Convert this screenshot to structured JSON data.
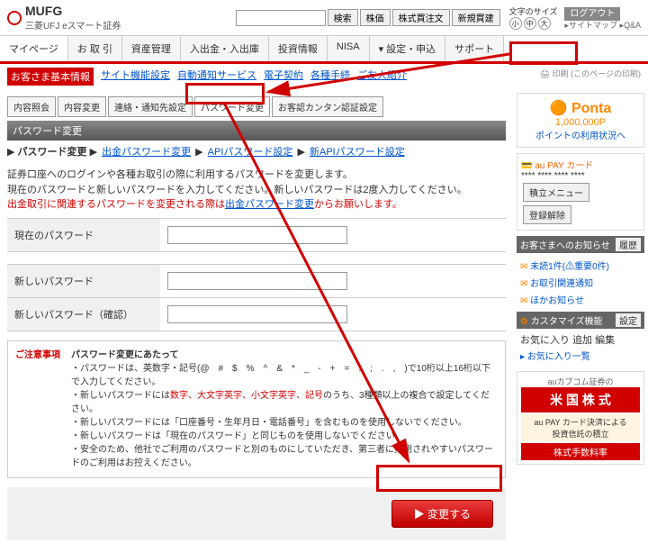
{
  "header": {
    "brand": "MUFG",
    "brand_sub": "三菱UFJ eスマート証券",
    "search_btn": "検索",
    "btn_price": "株価",
    "btn_order": "株式買注文",
    "btn_new": "新規買建",
    "fontsize_label": "文字のサイズ",
    "fs_s": "小",
    "fs_m": "中",
    "fs_l": "大",
    "logout": "ログアウト",
    "sitemap": "サイトマップ",
    "qa": "Q&A",
    "print": "印刷 (このページの印刷)"
  },
  "mainnav": [
    "マイページ",
    "お 取 引",
    "資産管理",
    "入出金・入出庫",
    "投資情報",
    "NISA",
    "設定・申込",
    "サポート"
  ],
  "subnav": {
    "red": "お客さま基本情報",
    "links": [
      "サイト機能設定",
      "自動通知サービス",
      "電子契約",
      "各種手続",
      "ご友人紹介"
    ]
  },
  "tabs": [
    "内容照会",
    "内容変更",
    "連絡・通知先設定",
    "パスワード変更",
    "お客認カンタン認証設定"
  ],
  "section_title": "パスワード変更",
  "breadcrumb": {
    "root": "パスワード変更",
    "links": [
      "出金パスワード変更",
      "APIパスワード設定",
      "新APIパスワード設定"
    ]
  },
  "desc": {
    "l1": "証券口座へのログインや各種お取引の際に利用するパスワードを変更します。",
    "l2": "現在のパスワードと新しいパスワードを入力してください。新しいパスワードは2度入力してください。",
    "l3_a": "出金取引に関連するパスワードを変更される際は",
    "l3_link": "出金パスワード変更",
    "l3_b": "からお願いします。"
  },
  "form": {
    "current": "現在のパスワード",
    "new": "新しいパスワード",
    "confirm": "新しいパスワード（確認）"
  },
  "notes": {
    "title": "ご注意事項",
    "head": "パスワード変更にあたって",
    "n1": "・パスワードは、英数字・記号(@　#　$　%　^　&　*　_　-　+　=　:　;　.　,　)で10桁以上16桁以下で入力してください。",
    "n2a": "・新しいパスワードには",
    "n2b": "数字、大文字英字、小文字英字、記号",
    "n2c": "のうち、3種類以上の複合で設定してください。",
    "n3": "・新しいパスワードには「口座番号・生年月日・電話番号」を含むものを使用しないでください。",
    "n4": "・新しいパスワードは「現在のパスワード」と同じものを使用しないでください。",
    "n5": "・安全のため、他社でご利用のパスワードと別のものにしていただき、第三者に推測されやすいパスワードのご利用はお控えください。"
  },
  "submit": "変更する",
  "sidebar": {
    "ponta_logo": "Ponta",
    "ponta_pts": "1,000,000P",
    "ponta_link": "ポイントの利用状況へ",
    "aupay": "au PAY カード",
    "aupay_mask": "**** **** **** ****",
    "btn_deposit": "積立メニュー",
    "btn_cancel": "登録解除",
    "notice_title": "お客さまへのお知らせ",
    "notice_btn": "履歴",
    "notices": [
      "未読1件(⚠重要0件)",
      "お取引関連通知",
      "ほかお知らせ"
    ],
    "custom_title": "カスタマイズ機能",
    "custom_btn": "設定",
    "fav_title": "お気に入り",
    "fav_add": "追加",
    "fav_edit": "編集",
    "fav_link": "お気に入り一覧",
    "banner_top": "auカブコム証券の",
    "banner_main": "米 国 株 式",
    "banner_sub1": "au PAY カード決済による",
    "banner_sub2": "投資信託の積立",
    "banner_sub3": "株式手数料率"
  }
}
